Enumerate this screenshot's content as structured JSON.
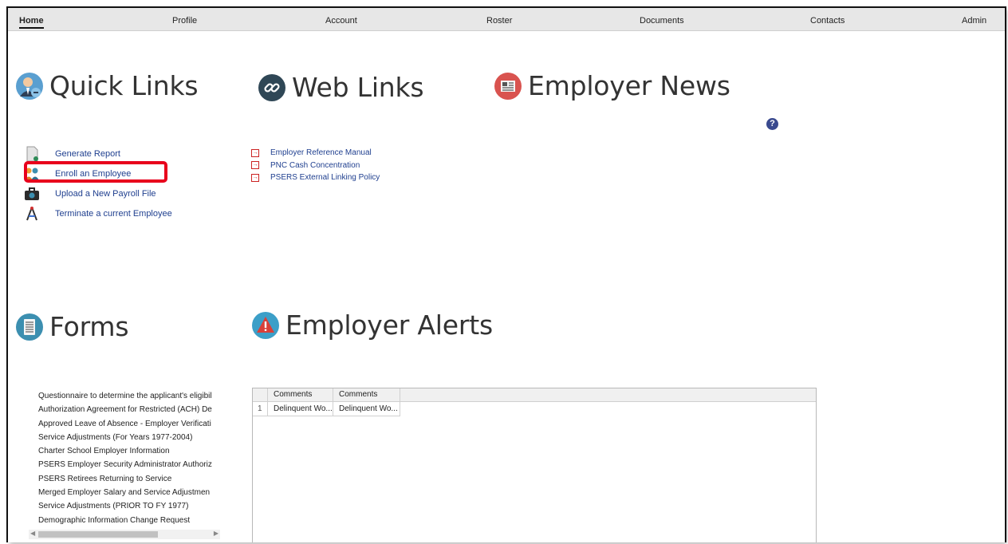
{
  "nav": {
    "items": [
      {
        "label": "Home",
        "active": true
      },
      {
        "label": "Profile"
      },
      {
        "label": "Account"
      },
      {
        "label": "Roster"
      },
      {
        "label": "Documents"
      },
      {
        "label": "Contacts"
      },
      {
        "label": "Admin"
      }
    ]
  },
  "quick_links": {
    "title": "Quick Links",
    "icon": "user-link-icon",
    "items": [
      {
        "label": "Generate Report",
        "icon": "report-doc-icon"
      },
      {
        "label": "Enroll an Employee",
        "icon": "enroll-people-icon"
      },
      {
        "label": "Upload a New Payroll File",
        "icon": "payroll-briefcase-icon"
      },
      {
        "label": "Terminate a current Employee",
        "icon": "compass-icon"
      }
    ]
  },
  "web_links": {
    "title": "Web Links",
    "icon": "chain-link-icon",
    "items": [
      {
        "label": "Employer Reference Manual"
      },
      {
        "label": "PNC Cash Concentration"
      },
      {
        "label": "PSERS External Linking Policy"
      }
    ]
  },
  "employer_news": {
    "title": "Employer News",
    "icon": "newspaper-icon",
    "help": "?"
  },
  "forms": {
    "title": "Forms",
    "icon": "document-icon",
    "items": [
      "Questionnaire to determine the applicant's eligibil",
      "Authorization Agreement for Restricted (ACH) De",
      "Approved Leave of Absence - Employer Verificati",
      "Service Adjustments (For Years 1977-2004)",
      "Charter School Employer Information",
      "PSERS Employer Security Administrator Authoriz",
      "PSERS Retirees Returning to Service",
      "Merged Employer Salary and Service Adjustmen",
      "Service Adjustments (PRIOR TO FY 1977)",
      "Demographic Information Change Request"
    ]
  },
  "employer_alerts": {
    "title": "Employer Alerts",
    "icon": "alert-triangle-icon",
    "columns": [
      "Comments",
      "Comments"
    ],
    "rows": [
      {
        "num": "1",
        "cells": [
          "Delinquent Wo...",
          "Delinquent Wo..."
        ]
      }
    ]
  },
  "colors": {
    "link": "#1f3f8f",
    "highlight": "#e8001c",
    "icon_teal": "#3c8fb0",
    "icon_red": "#d9534f"
  }
}
